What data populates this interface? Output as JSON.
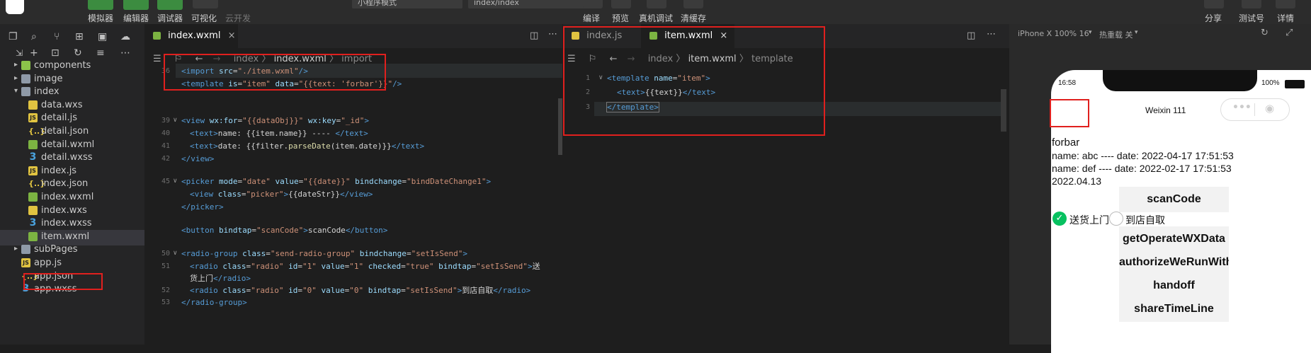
{
  "toolbar": {
    "simulator": "模拟器",
    "editor": "编辑器",
    "debugger": "调试器",
    "visual": "可视化",
    "cloud": "云开发",
    "mode_select": "小程序模式",
    "page_select": "index/index",
    "compile": "编译",
    "preview": "预览",
    "real_debug": "真机调试",
    "clear_cache": "清缓存",
    "share": "分享",
    "test_id": "测试号",
    "details": "详情"
  },
  "explorer": {
    "items": [
      {
        "name": "components",
        "type": "folder",
        "expanded": false
      },
      {
        "name": "image",
        "type": "folder",
        "expanded": false
      },
      {
        "name": "index",
        "type": "folder",
        "expanded": true
      },
      {
        "name": "data.wxs",
        "type": "wxs"
      },
      {
        "name": "detail.js",
        "type": "js"
      },
      {
        "name": "detail.json",
        "type": "json"
      },
      {
        "name": "detail.wxml",
        "type": "wxml"
      },
      {
        "name": "detail.wxss",
        "type": "wxss"
      },
      {
        "name": "index.js",
        "type": "js"
      },
      {
        "name": "index.json",
        "type": "json"
      },
      {
        "name": "index.wxml",
        "type": "wxml"
      },
      {
        "name": "index.wxs",
        "type": "wxs"
      },
      {
        "name": "index.wxss",
        "type": "wxss"
      },
      {
        "name": "item.wxml",
        "type": "wxml",
        "selected": true
      },
      {
        "name": "subPages",
        "type": "folder",
        "expanded": false
      },
      {
        "name": "app.js",
        "type": "js"
      },
      {
        "name": "app.json",
        "type": "json"
      },
      {
        "name": "app.wxss",
        "type": "wxss"
      }
    ]
  },
  "editor1": {
    "tab": "index.wxml",
    "crumbs": [
      "index",
      "index.wxml",
      "import"
    ],
    "line_numbers": [
      "36",
      "",
      "",
      "39",
      "40",
      "41",
      "42",
      "",
      "",
      "45",
      "",
      "",
      "",
      "",
      "",
      "50",
      "51",
      "",
      "52",
      "53"
    ]
  },
  "editor2": {
    "tabs": [
      "index.js",
      "item.wxml"
    ],
    "crumbs": [
      "index",
      "item.wxml",
      "template"
    ],
    "line_numbers": [
      "1",
      "2",
      "3"
    ]
  },
  "simulator": {
    "device": "iPhone X 100% 16",
    "hot_reload": "热重载 关",
    "time": "16:58",
    "battery": "100%",
    "nav_title": "Weixin 111",
    "forbar": "forbar",
    "row1": "name: abc ---- date: 2022-04-17 17:51:53",
    "row2": "name: def ---- date: 2022-02-17 17:51:53",
    "date": "2022.04.13",
    "radio_send": "送货上门",
    "radio_pickup": "到店自取",
    "buttons": [
      "scanCode",
      "getOperateWXData",
      "authorizeWeRunWithoutPopup",
      "handoff",
      "shareTimeLine"
    ]
  }
}
